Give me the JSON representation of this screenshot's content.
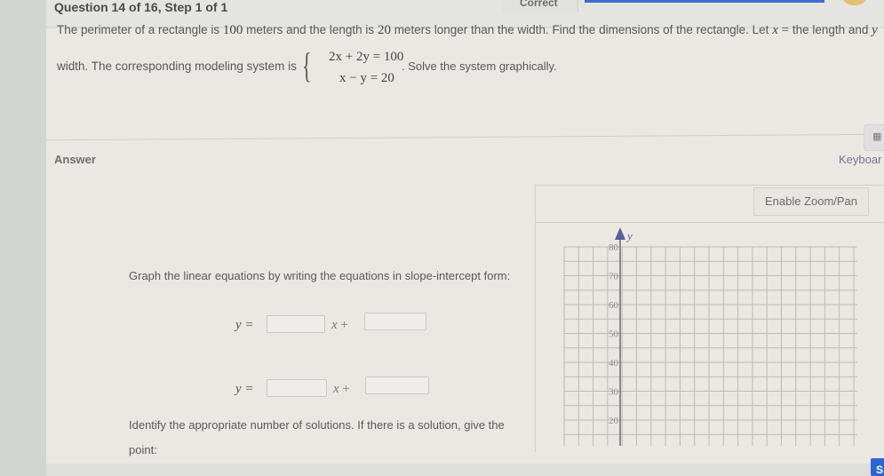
{
  "header": {
    "question_title": "Question 14 of 16, Step 1 of 1",
    "status": "Correct"
  },
  "question": {
    "text_line1_a": "The perimeter of a rectangle is ",
    "perimeter": "100",
    "text_line1_b": " meters and the length is ",
    "difference": "20",
    "text_line1_c": " meters longer than the width. Find the dimensions of the rectangle. Let ",
    "var_x": "x",
    "equals": " = ",
    "text_line1_d": " the length and ",
    "var_y": "y",
    "text_line2_a": "width. The corresponding modeling system is",
    "system": {
      "equation1": "2x + 2y = 100",
      "equation2": "x − y = 20"
    },
    "text_line2_b": ". Solve the system graphically."
  },
  "answer": {
    "label": "Answer",
    "keyboard_label": "Keyboar",
    "keyboard_icon": "calculator-keyboard-icon",
    "instructions": "Graph the linear equations by writing the equations in slope-intercept form:",
    "equation_rows": [
      {
        "lhs": "y =",
        "var": "x",
        "plus": "+",
        "slope_value": "",
        "intercept_value": ""
      },
      {
        "lhs": "y =",
        "var": "x",
        "plus": "+",
        "slope_value": "",
        "intercept_value": ""
      }
    ],
    "identify_text": "Identify the appropriate number of solutions. If there is a solution, give the",
    "point_label": "point:",
    "submit_label": "S"
  },
  "graph": {
    "zoom_button": "Enable Zoom/Pan",
    "y_axis_label": "y",
    "y_ticks": [
      "80",
      "70",
      "60",
      "50",
      "40",
      "30",
      "20"
    ],
    "y_tick_values": [
      80,
      70,
      60,
      50,
      40,
      30,
      20
    ],
    "grid_step": 5,
    "axis_color": "#6b6b72",
    "arrow_color": "#5b5f9a"
  }
}
